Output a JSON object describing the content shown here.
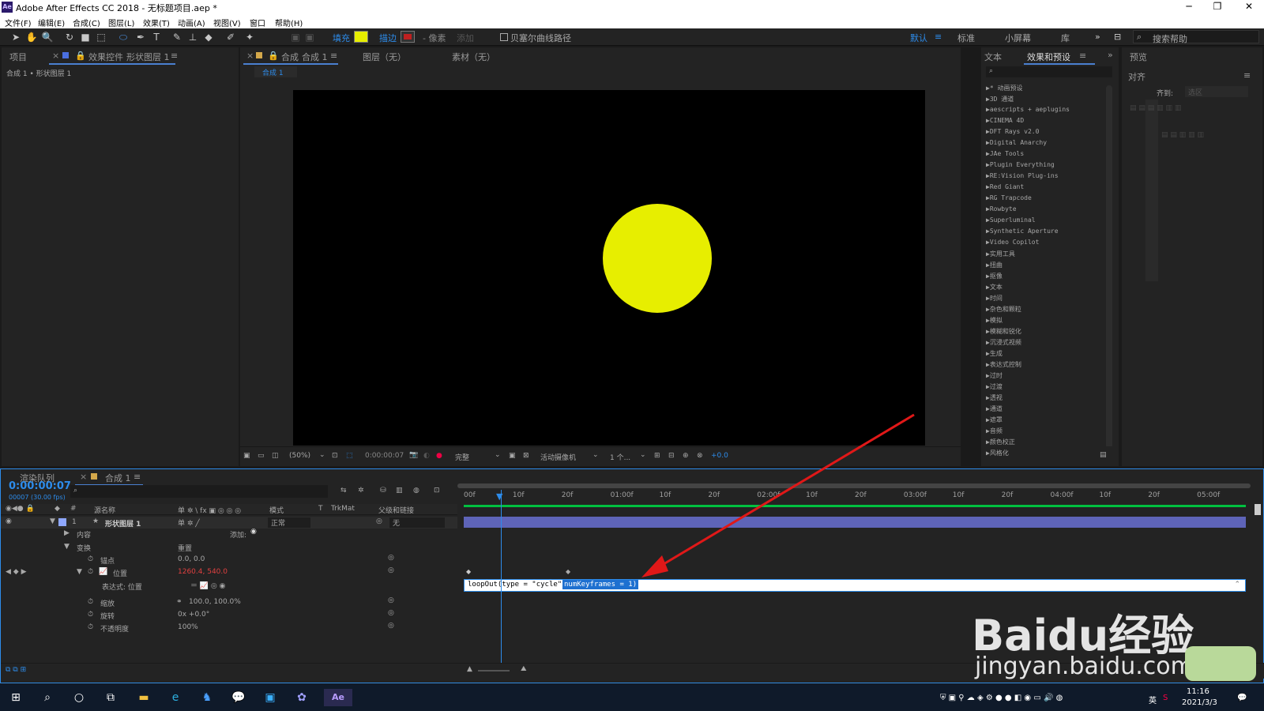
{
  "window": {
    "title": "Adobe After Effects CC 2018 - 无标题项目.aep *",
    "app_icon": "Ae"
  },
  "menu": [
    "文件(F)",
    "编辑(E)",
    "合成(C)",
    "图层(L)",
    "效果(T)",
    "动画(A)",
    "视图(V)",
    "窗口",
    "帮助(H)"
  ],
  "toolbar": {
    "fill_label": "填充",
    "stroke_label": "描边",
    "px_label": "- 像素",
    "add_label": "添加",
    "bezier_label": "贝塞尔曲线路径",
    "workspaces": [
      "默认",
      "标准",
      "小屏幕",
      "库"
    ],
    "search_placeholder": "搜索帮助",
    "fill_color": "#e7ee00",
    "stroke_color": "#c02020"
  },
  "left_panel": {
    "tab_project": "项目",
    "tab_effects": "效果控件",
    "tab_effects_layer": "形状图层 1",
    "breadcrumb": "合成 1 • 形状图层 1"
  },
  "comp_panel": {
    "tab_comp": "合成",
    "tab_comp_name": "合成 1",
    "tab_layer": "图层（无）",
    "tab_footage": "素材（无）",
    "subtab": "合成 1",
    "zoom": "(50%)",
    "timecode": "0:00:00:07",
    "quality": "完整",
    "camera": "活动摄像机",
    "views": "1 个...",
    "exposure": "+0.0"
  },
  "right_panel": {
    "tab_info": "文本",
    "tab_effects": "效果和预设",
    "search_placeholder": "",
    "items": [
      "* 动画预设",
      "3D 通道",
      "aescripts + aeplugins",
      "CINEMA 4D",
      "DFT Rays v2.0",
      "Digital Anarchy",
      "JAe Tools",
      "Plugin Everything",
      "RE:Vision Plug-ins",
      "Red Giant",
      "RG Trapcode",
      "Rowbyte",
      "Superluminal",
      "Synthetic Aperture",
      "Video Copilot",
      "实用工具",
      "扭曲",
      "抠像",
      "文本",
      "时间",
      "杂色和颗粒",
      "模拟",
      "模糊和锐化",
      "沉浸式视频",
      "生成",
      "表达式控制",
      "过时",
      "过渡",
      "透视",
      "通道",
      "遮罩",
      "音频",
      "颜色校正",
      "风格化"
    ]
  },
  "far_right": {
    "tab_preview": "预览",
    "tab_align": "对齐",
    "align_to_label": "齐到:",
    "align_to_value": "选区"
  },
  "timeline": {
    "tab_render": "渲染队列",
    "tab_comp": "合成 1",
    "timecode": "0:00:00:07",
    "fps": "00007 (30.00 fps)",
    "headers": {
      "num": "#",
      "source": "源名称",
      "switches": "单 ✲ \\ fx ▣ ◎ ◎ ◎",
      "mode": "模式",
      "t": "T",
      "trkmat": "TrkMat",
      "parent": "父级和链接"
    },
    "layer": {
      "num": "1",
      "name": "形状图层 1",
      "mode": "正常",
      "parent": "无"
    },
    "rows": {
      "contents": "内容",
      "add": "添加:",
      "transform": "变换",
      "reset": "重置",
      "anchor": "锚点",
      "anchor_val": "0.0, 0.0",
      "position": "位置",
      "position_val": "1260.4, 540.0",
      "expression_label": "表达式: 位置",
      "scale": "缩放",
      "scale_val": "100.0, 100.0%",
      "rotation": "旋转",
      "rotation_val": "0x +0.0°",
      "opacity": "不透明度",
      "opacity_val": "100%"
    },
    "expression": {
      "text": "loopOut(type = \"cycle\", ",
      "highlight": "numKeyframes = 1)"
    },
    "ruler": [
      "00f",
      "10f",
      "20f",
      "01:00f",
      "10f",
      "20f",
      "02:00f",
      "10f",
      "20f",
      "03:00f",
      "10f",
      "20f",
      "04:00f",
      "10f",
      "20f",
      "05:00f"
    ],
    "playhead_frame": 7
  },
  "taskbar": {
    "time": "11:16",
    "date": "2021/3/3",
    "ime": "英"
  },
  "watermark": {
    "brand": "Baidu经验",
    "url": "jingyan.baidu.com"
  }
}
